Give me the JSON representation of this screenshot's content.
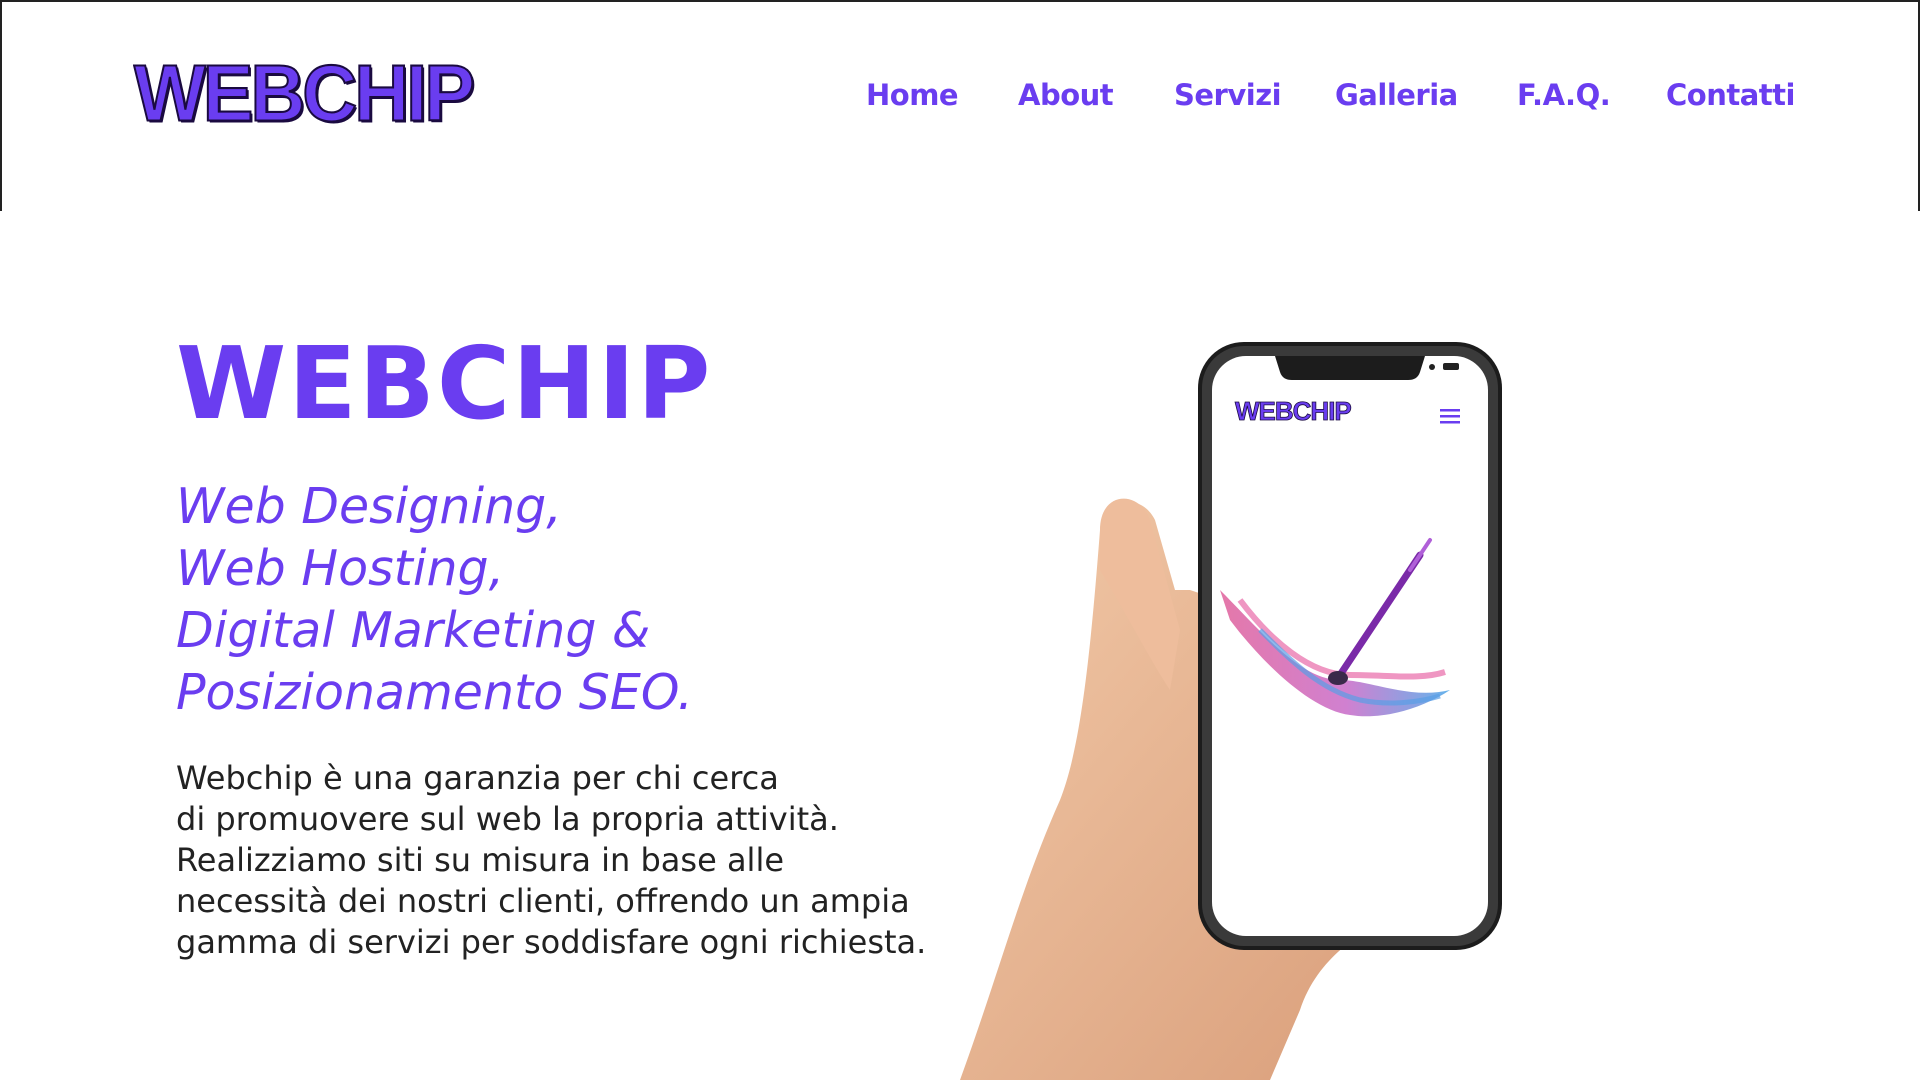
{
  "header": {
    "logo": "WEBCHIP",
    "nav": [
      "Home",
      "About",
      "Servizi",
      "Galleria",
      "F.A.Q.",
      "Contatti"
    ]
  },
  "hero": {
    "title": "WEBCHIP",
    "subtitle_lines": [
      "Web Designing,",
      "Web Hosting,",
      "Digital Marketing &",
      "Posizionamento SEO."
    ],
    "description_lines": [
      "Webchip è una garanzia per chi cerca",
      "di promuovere sul web la propria attività.",
      "Realizziamo siti su misura in base alle",
      "necessità dei nostri clienti, offrendo un ampia",
      "gamma di servizi per soddisfare ogni richiesta."
    ]
  },
  "phone": {
    "logo": "WEBCHIP",
    "menu_icon": "hamburger-icon",
    "illustration": "paintbrush-icon"
  },
  "colors": {
    "brand": "#6a3df0",
    "text": "#222222",
    "background": "#ffffff"
  }
}
